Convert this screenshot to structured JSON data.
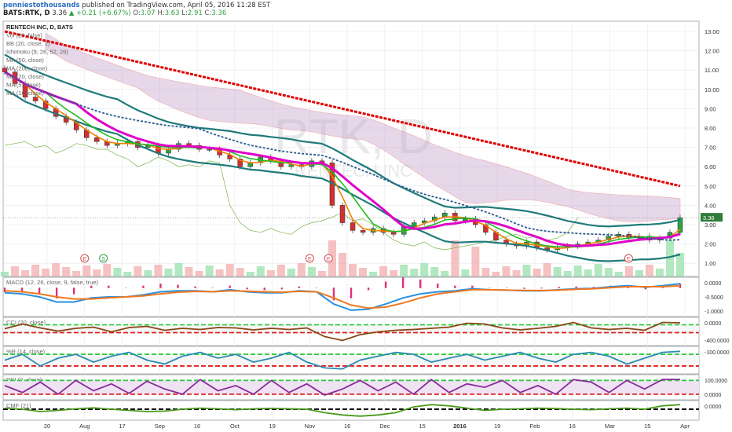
{
  "header": {
    "author": "penniestothousands",
    "published": "published on TradingView.com, April 05, 2016 11:28 EST",
    "symbol": "BATS:RTK, D",
    "last": "3.36",
    "change": "▲ +0.21 (+6.67%)",
    "o_label": "O:",
    "o_value": "3.07",
    "h_label": "H:",
    "h_value": "3.63",
    "l_label": "L:",
    "l_value": "2.91",
    "c_label": "C:",
    "c_value": "3.36"
  },
  "watermark": {
    "symbol": "RTK, D",
    "name": "RENTECH INC"
  },
  "indicators": [
    "RENTECH INC, D, BATS",
    "Vol (20, false)",
    "BB (20, close, 2)",
    "Ichimoku (9, 26, 52, 26)",
    "MA (50, close)",
    "MA (200, close)",
    "MA (20, close)",
    "MA (5, close)",
    "MA (10, close)"
  ],
  "colors": {
    "up": "#2ea043",
    "down": "#d03030",
    "ma200": "#e00000",
    "ma50": "#2a5b8c",
    "bb": "#1f7a7a",
    "ma20": "#e000c8",
    "ma10": "#22bb22",
    "ma5": "#f08000",
    "cloud": "#c8a8d0",
    "macd": "#2a90e0",
    "signal": "#f07820",
    "hist": "#e0307a",
    "cci": "#8b4513",
    "wr": "#2a8cb0",
    "rsi": "#8a2a9a",
    "cmf": "#4a9a1a",
    "upper_dash": "#2ecc40",
    "lower_dash": "#e02020"
  },
  "chart_data": {
    "type": "candlestick",
    "symbol": "RTK",
    "timeframe": "D",
    "y_axis_ticks": [
      "13.00",
      "12.00",
      "11.00",
      "10.00",
      "9.00",
      "8.00",
      "7.00",
      "6.00",
      "5.00",
      "4.00",
      "3.00",
      "2.00",
      "1.00"
    ],
    "last_price_label": "3.36",
    "x_axis_ticks": [
      "20",
      "Aug",
      "17",
      "Sep",
      "16",
      "Oct",
      "19",
      "Nov",
      "16",
      "Dec",
      "15",
      "2016",
      "19",
      "Feb",
      "16",
      "Mar",
      "15",
      "Apr"
    ],
    "ma200_start": 13.0,
    "ma200_end": 5.0,
    "close": [
      10.9,
      10.3,
      9.6,
      9.4,
      9.0,
      8.6,
      8.3,
      7.9,
      7.5,
      7.3,
      7.1,
      7.2,
      7.3,
      7.0,
      7.1,
      6.7,
      6.9,
      7.2,
      7.1,
      6.9,
      6.9,
      6.6,
      6.4,
      6.0,
      6.2,
      6.5,
      6.3,
      6.0,
      6.1,
      6.0,
      6.3,
      6.2,
      4.0,
      3.1,
      2.7,
      2.6,
      2.8,
      2.6,
      2.5,
      2.9,
      3.1,
      3.2,
      3.4,
      3.6,
      3.2,
      3.3,
      3.0,
      2.6,
      2.2,
      2.0,
      1.9,
      2.1,
      1.8,
      1.7,
      1.8,
      1.9,
      2.0,
      2.1,
      2.2,
      2.4,
      2.5,
      2.3,
      2.4,
      2.2,
      2.3,
      2.6,
      3.36
    ],
    "events": [
      {
        "label": "E",
        "position": "Aug"
      },
      {
        "label": "S",
        "position": "Aug 17"
      },
      {
        "label": "E",
        "position": "Nov"
      },
      {
        "label": "E",
        "position": "Nov 16"
      },
      {
        "label": "E",
        "position": "Mar 15"
      }
    ],
    "panes": [
      {
        "name": "MACD (12, 26, close, 9, false, true)",
        "ticks": [
          "0.0000",
          "-0.5000",
          "-1.0000"
        ],
        "levels": [
          0.0,
          -0.5,
          -1.0
        ],
        "macd": [
          -0.25,
          -0.3,
          -0.45,
          -0.7,
          -0.7,
          -0.5,
          -0.45,
          -0.45,
          -0.35,
          -0.2,
          -0.15,
          -0.15,
          -0.2,
          -0.1,
          -0.2,
          -0.25,
          -0.25,
          -0.15,
          -0.2,
          -0.8,
          -1.1,
          -1.05,
          -0.8,
          -0.5,
          -0.3,
          -0.2,
          -0.15,
          -0.05,
          -0.1,
          -0.12,
          -0.15,
          -0.15,
          -0.1,
          -0.05,
          -0.03,
          0.05,
          0.1,
          0.02,
          0.1,
          0.2
        ],
        "signal": [
          -0.15,
          -0.2,
          -0.3,
          -0.45,
          -0.55,
          -0.55,
          -0.5,
          -0.45,
          -0.4,
          -0.3,
          -0.22,
          -0.18,
          -0.2,
          -0.15,
          -0.17,
          -0.2,
          -0.22,
          -0.18,
          -0.2,
          -0.5,
          -0.85,
          -1.0,
          -0.95,
          -0.75,
          -0.5,
          -0.3,
          -0.2,
          -0.1,
          -0.1,
          -0.12,
          -0.13,
          -0.14,
          -0.12,
          -0.08,
          -0.05,
          0.0,
          0.05,
          0.05,
          0.05,
          0.1
        ]
      },
      {
        "name": "CCI (20, close)",
        "ticks": [
          "0.0000",
          "-400.0000"
        ],
        "levels": [
          100,
          -100
        ],
        "values": [
          0,
          120,
          20,
          -60,
          10,
          40,
          -80,
          30,
          60,
          -40,
          10,
          -20,
          30,
          20,
          -30,
          10,
          -20,
          20,
          -200,
          -300,
          -150,
          -80,
          -40,
          -20,
          10,
          40,
          140,
          120,
          20,
          -30,
          10,
          60,
          160,
          20,
          -20,
          10,
          -40,
          160,
          150
        ]
      },
      {
        "name": "%R (14, close)",
        "ticks": [
          "-100.0000"
        ],
        "levels": [
          -20,
          -80
        ],
        "values": [
          -50,
          -20,
          -80,
          -40,
          -20,
          -60,
          -30,
          -10,
          -50,
          -70,
          -30,
          -10,
          -40,
          -20,
          -60,
          -40,
          -10,
          -60,
          -90,
          -95,
          -50,
          -30,
          -10,
          -20,
          -60,
          -40,
          -20,
          -50,
          -30,
          -10,
          -40,
          -60,
          -20,
          -10,
          -30,
          -70,
          -40,
          -10,
          -5
        ]
      },
      {
        "name": "RSI (2, close)",
        "ticks": [
          "100.0000",
          "0.0000"
        ],
        "levels": [
          90,
          10
        ],
        "values": [
          60,
          20,
          80,
          10,
          90,
          30,
          70,
          15,
          85,
          40,
          10,
          95,
          30,
          60,
          10,
          90,
          20,
          70,
          5,
          40,
          90,
          30,
          80,
          10,
          95,
          20,
          70,
          50,
          90,
          20,
          60,
          10,
          95,
          80,
          20,
          90,
          40,
          95,
          96
        ]
      },
      {
        "name": "CMF (21)",
        "ticks": [
          "0.0000"
        ],
        "levels": [
          0
        ],
        "values": [
          0.05,
          0.0,
          -0.1,
          -0.05,
          0.02,
          0.06,
          0.0,
          -0.05,
          -0.1,
          -0.08,
          0.0,
          0.05,
          0.02,
          -0.02,
          0.02,
          0.04,
          0.02,
          0.0,
          -0.15,
          -0.25,
          -0.3,
          -0.25,
          -0.15,
          0.1,
          0.2,
          0.15,
          0.05,
          -0.05,
          0.0,
          0.02,
          0.05,
          0.03,
          0.0,
          -0.02,
          0.02,
          0.05,
          0.0,
          0.15,
          0.2
        ]
      }
    ]
  }
}
